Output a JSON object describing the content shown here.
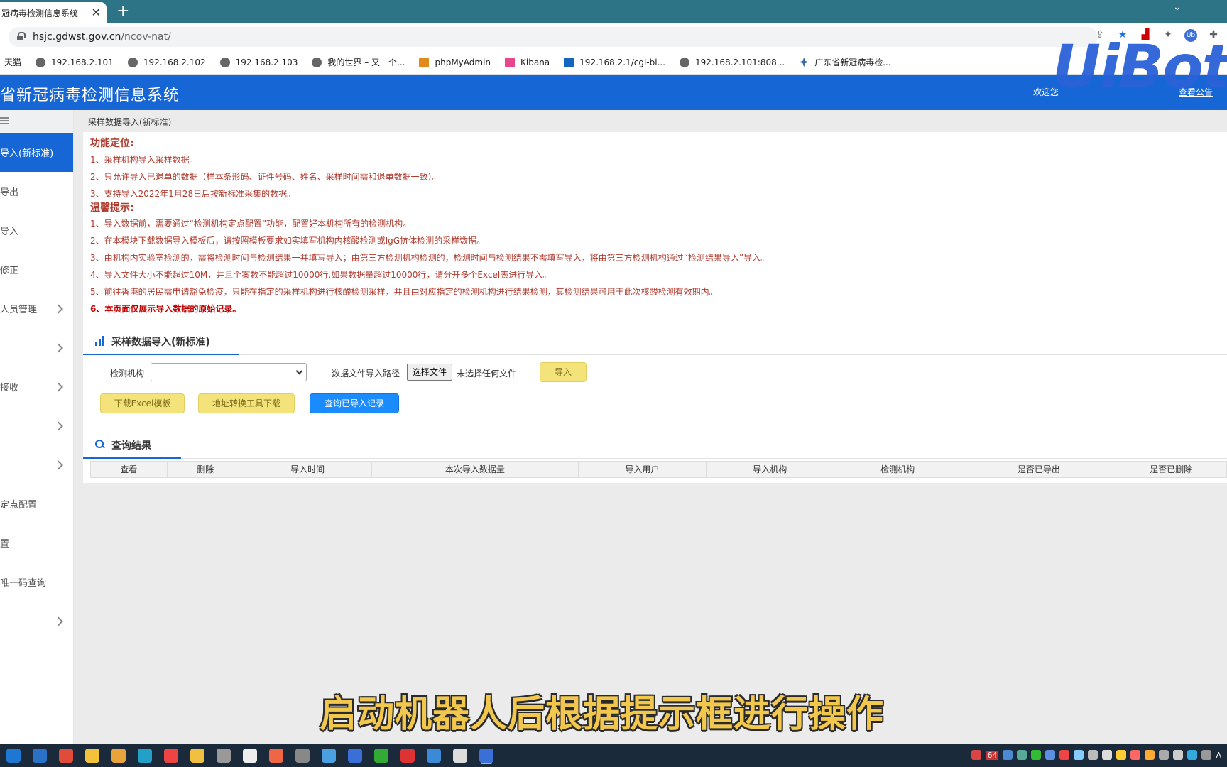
{
  "browser": {
    "tab_title": "冠病毒检测信息系统",
    "tab_close": "✕",
    "new_tab": "+",
    "tab_menu": "⌄",
    "url_host": "hsjc.gdwst.gov.cn",
    "url_path": "/ncov-nat/",
    "ub_badge": "Ub",
    "bookmarks": [
      {
        "label": "天猫",
        "icon": "tmall-icon"
      },
      {
        "label": "192.168.2.101",
        "icon": "globe-icon"
      },
      {
        "label": "192.168.2.102",
        "icon": "globe-icon"
      },
      {
        "label": "192.168.2.103",
        "icon": "globe-icon"
      },
      {
        "label": "我的世界 – 又一个...",
        "icon": "globe-icon"
      },
      {
        "label": "phpMyAdmin",
        "icon": "phpmyadmin-icon"
      },
      {
        "label": "Kibana",
        "icon": "kibana-icon"
      },
      {
        "label": "192.168.2.1/cgi-bi...",
        "icon": "cgi-icon"
      },
      {
        "label": "192.168.2.101:808...",
        "icon": "globe-icon"
      },
      {
        "label": "广东省新冠病毒检...",
        "icon": "gd-icon"
      }
    ]
  },
  "header": {
    "title": "省新冠病毒检测信息系统",
    "welcome": "欢迎您",
    "notice_link": "查看公告",
    "watermark": "UiBot"
  },
  "sidebar": {
    "items": [
      {
        "label": "导入(新标准)",
        "active": true,
        "chevron": false
      },
      {
        "label": "导出",
        "active": false,
        "chevron": false
      },
      {
        "label": "导入",
        "active": false,
        "chevron": false
      },
      {
        "label": "修正",
        "active": false,
        "chevron": false
      },
      {
        "label": "人员管理",
        "active": false,
        "chevron": true
      },
      {
        "label": "",
        "active": false,
        "chevron": true
      },
      {
        "label": "接收",
        "active": false,
        "chevron": true
      },
      {
        "label": "",
        "active": false,
        "chevron": true
      },
      {
        "label": "",
        "active": false,
        "chevron": true
      },
      {
        "label": "定点配置",
        "active": false,
        "chevron": false
      },
      {
        "label": "置",
        "active": false,
        "chevron": false
      },
      {
        "label": "唯一码查询",
        "active": false,
        "chevron": false
      },
      {
        "label": "",
        "active": false,
        "chevron": true
      }
    ]
  },
  "breadcrumb": "采样数据导入(新标准)",
  "notice": {
    "section1_title": "功能定位:",
    "section1_lines": [
      "1、采样机构导入采样数据。",
      "2、只允许导入已退单的数据（样本条形码、证件号码、姓名、采样时间需和退单数据一致）。",
      "3、支持导入2022年1月28日后按新标准采集的数据。"
    ],
    "section2_title": "温馨提示:",
    "section2_lines": [
      "1、导入数据前，需要通过“检测机构定点配置”功能，配置好本机构所有的检测机构。",
      "2、在本模块下载数据导入模板后，请按照模板要求如实填写机构内核酸检测或IgG抗体检测的采样数据。",
      "3、由机构内实验室检测的，需将检测时间与检测结果一并填写导入；由第三方检测机构检测的，检测时间与检测结果不需填写导入，将由第三方检测机构通过“检测结果导入”导入。",
      "4、导入文件大小不能超过10M，并且个案数不能超过10000行,如果数据量超过10000行，请分开多个Excel表进行导入。",
      "5、前往香港的居民需申请豁免检疫，只能在指定的采样机构进行核酸检测采样，并且由对应指定的检测机构进行结果检测，其检测结果可用于此次核酸检测有效期内。"
    ],
    "section2_strong": "6、本页面仅展示导入数据的原始记录。"
  },
  "import": {
    "title": "采样数据导入(新标准)",
    "org_label": "检测机构",
    "org_value": "",
    "path_label": "数据文件导入路径",
    "file_button": "选择文件",
    "no_file": "未选择任何文件",
    "import_button": "导入",
    "download_template_button": "下载Excel模板",
    "address_tool_button": "地址转换工具下载",
    "query_imported_button": "查询已导入记录"
  },
  "results": {
    "title": "查询结果",
    "columns": [
      "查看",
      "删除",
      "导入时间",
      "本次导入数据量",
      "导入用户",
      "导入机构",
      "检测机构",
      "是否已导出",
      "是否已删除"
    ]
  },
  "subtitle": "启动机器人后根据提示框进行操作",
  "taskbar": {
    "badge_count": "64",
    "input_method": "A"
  },
  "colors": {
    "header_blue": "#1666d6",
    "notice_red": "#b03a2e",
    "button_yellow": "#f4e27a",
    "button_blue": "#1a8cff",
    "subtitle_gold": "#f2c74e"
  }
}
